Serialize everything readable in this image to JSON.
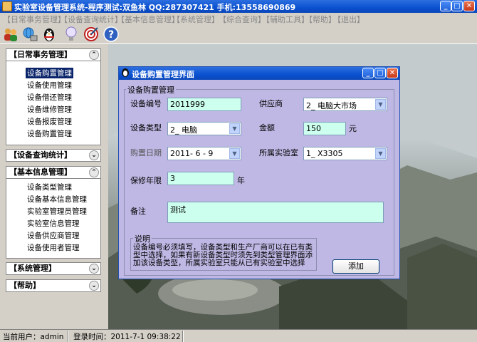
{
  "window": {
    "title": "实验室设备管理系统-程序测试:双鱼林  QQ:287307421  手机:13558690869"
  },
  "menu": {
    "items": [
      "【日常事务管理】",
      "【设备查询统计】",
      "【基本信息管理】",
      "【系统管理】",
      "【综合查询】",
      "【辅助工具】",
      "【帮助】",
      "【退出】"
    ]
  },
  "toolbar": {
    "icons": [
      "users-icon",
      "globe-network-icon",
      "penguin-icon",
      "lightbulb-icon",
      "target-icon",
      "help-icon"
    ]
  },
  "sidebar": {
    "panels": [
      {
        "title": "【日常事务管理】",
        "expanded": true,
        "items": [
          "设备购置管理",
          "设备使用管理",
          "设备借还管理",
          "设备维修管理",
          "设备报废管理",
          "设备购置管理"
        ],
        "active_index": 0
      },
      {
        "title": "【设备查询统计】",
        "expanded": false,
        "items": []
      },
      {
        "title": "【基本信息管理】",
        "expanded": true,
        "items": [
          "设备类型管理",
          "设备基本信息管理",
          "实验室管理员管理",
          "实验室信息管理",
          "设备供应商管理",
          "设备使用者管理"
        ]
      },
      {
        "title": "【系统管理】",
        "expanded": false,
        "items": []
      },
      {
        "title": "【帮助】",
        "expanded": false,
        "items": []
      }
    ]
  },
  "dialog": {
    "title": "设备购置管理界面",
    "group_title": "设备购置管理",
    "fields": {
      "code": {
        "label": "设备编号",
        "value": "2011999"
      },
      "supplier": {
        "label": "供应商",
        "value": "2_ 电脑大市场"
      },
      "type": {
        "label": "设备类型",
        "value": "2_ 电脑"
      },
      "amount": {
        "label": "金额",
        "value": "150",
        "unit": "元"
      },
      "date": {
        "label": "购置日期",
        "value": "2011- 6 - 9"
      },
      "lab": {
        "label": "所属实验室",
        "value": "1_ X3305"
      },
      "warranty": {
        "label": "保修年限",
        "value": "3",
        "unit": "年"
      },
      "remark": {
        "label": "备注",
        "value": "测试"
      }
    },
    "note": {
      "title": "说明",
      "line1": "设备编号必须填写，设备类型和生产厂商可以在已有类",
      "line2": "型中选择，如果有新设备类型时须先到类型管理界面添",
      "line3": "加该设备类型，所属实验室只能从已有实验室中选择"
    },
    "add_button": "添加"
  },
  "status": {
    "user": "当前用户：admin",
    "login_time": "登录时间：2011-7-1 09:38:22"
  }
}
